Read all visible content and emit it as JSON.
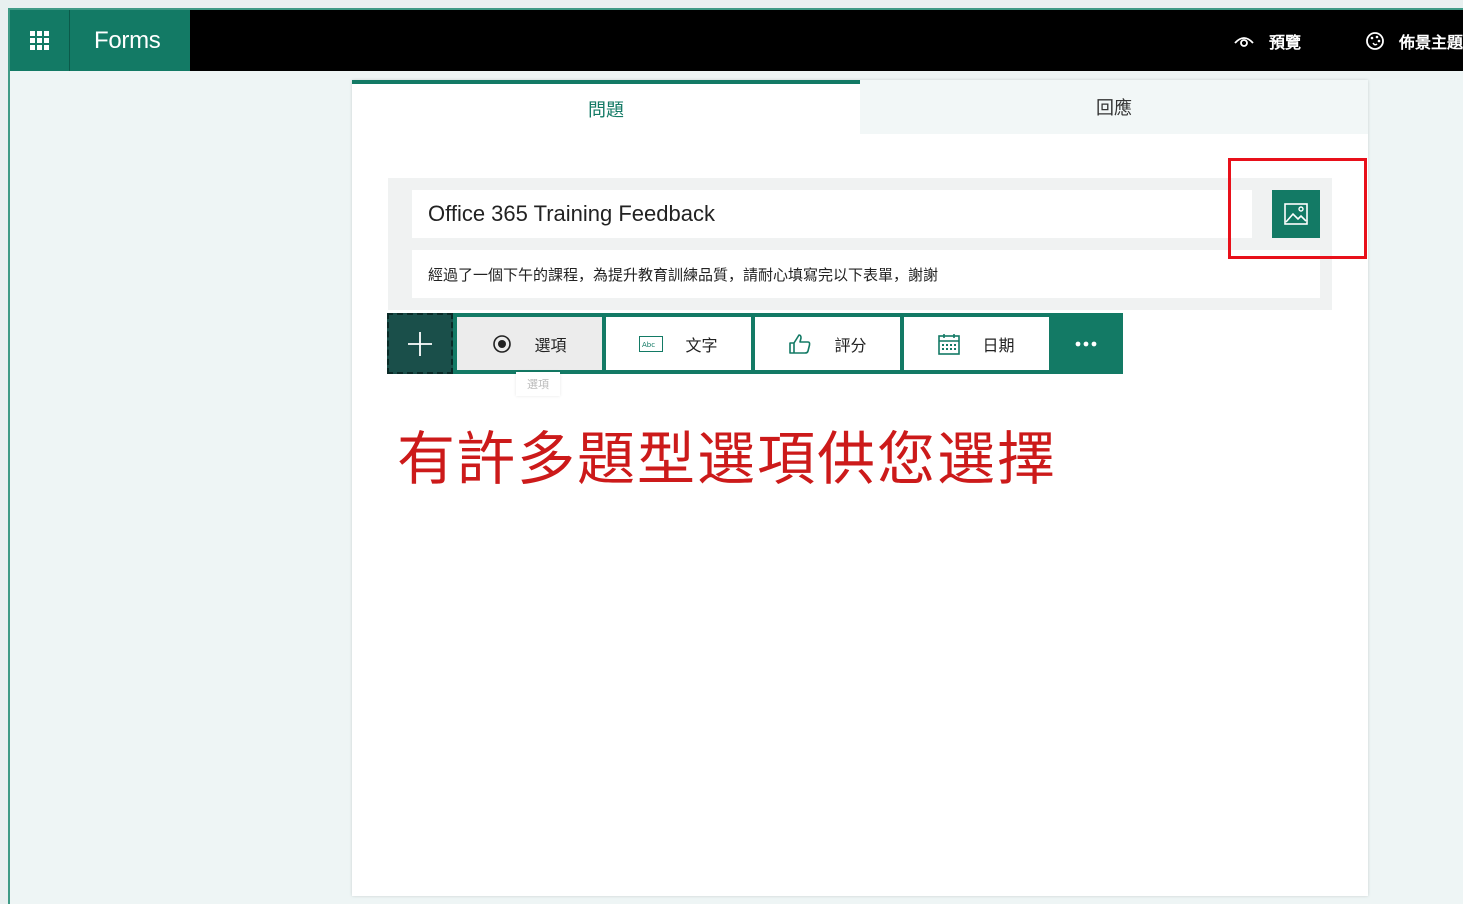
{
  "app": {
    "name": "Forms",
    "waffle_icon": "app-launcher-icon"
  },
  "top_actions": {
    "preview_label": "預覽",
    "theme_label": "佈景主題"
  },
  "tabs": [
    {
      "label": "問題",
      "active": true
    },
    {
      "label": "回應",
      "active": false
    }
  ],
  "form": {
    "title": "Office 365 Training Feedback",
    "description": "經過了一個下午的課程，為提升教育訓練品質，請耐心填寫完以下表單，謝謝",
    "image_button_icon": "image-icon"
  },
  "question_types": [
    {
      "label": "選項",
      "icon": "radio-choice-icon"
    },
    {
      "label": "文字",
      "icon": "text-abc-icon"
    },
    {
      "label": "評分",
      "icon": "thumbs-up-icon"
    },
    {
      "label": "日期",
      "icon": "calendar-icon"
    }
  ],
  "tooltip": "選項",
  "annotation": "有許多題型選項供您選擇",
  "colors": {
    "brand": "#137a65",
    "annotation": "#cc1a1a",
    "highlight": "#e8101a"
  }
}
